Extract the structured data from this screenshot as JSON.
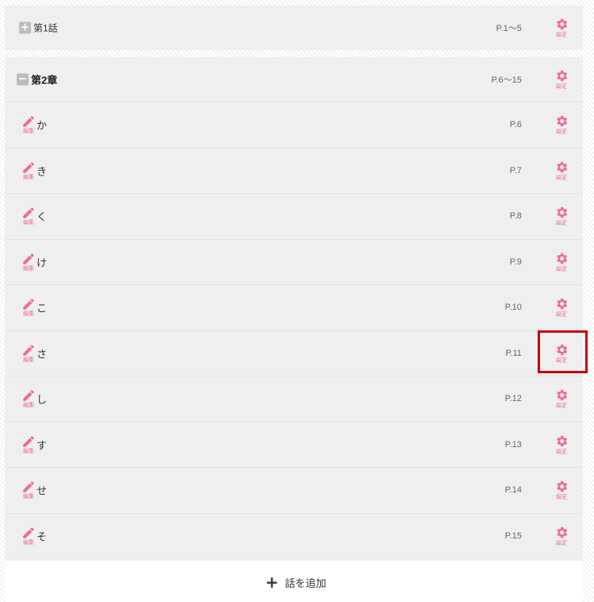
{
  "chapter1": {
    "toggle": "+",
    "title": "第1話",
    "pages": "P.1〜5",
    "settings_label": "設定"
  },
  "chapter2": {
    "toggle": "−",
    "title": "第2章",
    "pages": "P.6〜15",
    "settings_label": "設定",
    "episodes": [
      {
        "title": "か",
        "page": "P.6",
        "edit_label": "編集",
        "settings_label": "設定"
      },
      {
        "title": "き",
        "page": "P.7",
        "edit_label": "編集",
        "settings_label": "設定"
      },
      {
        "title": "く",
        "page": "P.8",
        "edit_label": "編集",
        "settings_label": "設定"
      },
      {
        "title": "け",
        "page": "P.9",
        "edit_label": "編集",
        "settings_label": "設定"
      },
      {
        "title": "こ",
        "page": "P.10",
        "edit_label": "編集",
        "settings_label": "設定"
      },
      {
        "title": "さ",
        "page": "P.11",
        "edit_label": "編集",
        "settings_label": "設定"
      },
      {
        "title": "し",
        "page": "P.12",
        "edit_label": "編集",
        "settings_label": "設定"
      },
      {
        "title": "す",
        "page": "P.13",
        "edit_label": "編集",
        "settings_label": "設定"
      },
      {
        "title": "せ",
        "page": "P.14",
        "edit_label": "編集",
        "settings_label": "設定"
      },
      {
        "title": "そ",
        "page": "P.15",
        "edit_label": "編集",
        "settings_label": "設定"
      }
    ]
  },
  "add": {
    "icon": "plus-icon",
    "label": "話を追加"
  },
  "colors": {
    "accent": "#f06a8e",
    "highlight": "#cc0000",
    "row_bg": "#efefef"
  }
}
